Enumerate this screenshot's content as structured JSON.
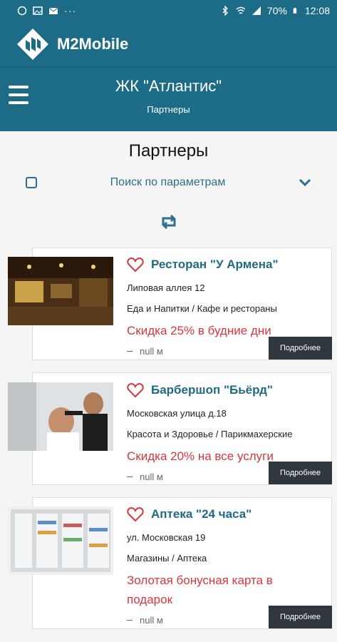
{
  "status_bar": {
    "battery": "70%",
    "time": "12:08",
    "icons": [
      "whatsapp-icon",
      "gallery-icon",
      "email-icon",
      "more-dots-icon",
      "bluetooth-icon",
      "wifi-icon",
      "signal-icon",
      "battery-icon"
    ]
  },
  "app": {
    "name": "M2Mobile"
  },
  "header": {
    "title": "ЖК \"Атлантис\"",
    "subtitle": "Партнеры"
  },
  "main": {
    "page_title": "Партнеры",
    "search_label": "Поиск по параметрам",
    "partners": [
      {
        "title": "Ресторан \"У Армена\"",
        "address": "Липовая аллея 12",
        "category": "Еда и Напитки / Кафе и рестораны",
        "promo": "Скидка 25% в будние дни",
        "distance": "null м",
        "more_label": "Подробнее"
      },
      {
        "title": "Барбершоп \"Бьёрд\"",
        "address": "Московская улица д.18",
        "category": "Красота и Здоровье / Парикмахерские",
        "promo": "Скидка 20% на все услуги",
        "distance": "null м",
        "more_label": "Подробнее"
      },
      {
        "title": "Аптека \"24 часа\"",
        "address": "ул. Московская 19",
        "category": "Магазины / Аптека",
        "promo": "Золотая бонусная карта в подарок",
        "distance": "null м",
        "more_label": "Подробнее"
      }
    ]
  },
  "colors": {
    "primary": "#1d6c87",
    "accent_red": "#d9363e",
    "button_dark": "#2f363d"
  }
}
